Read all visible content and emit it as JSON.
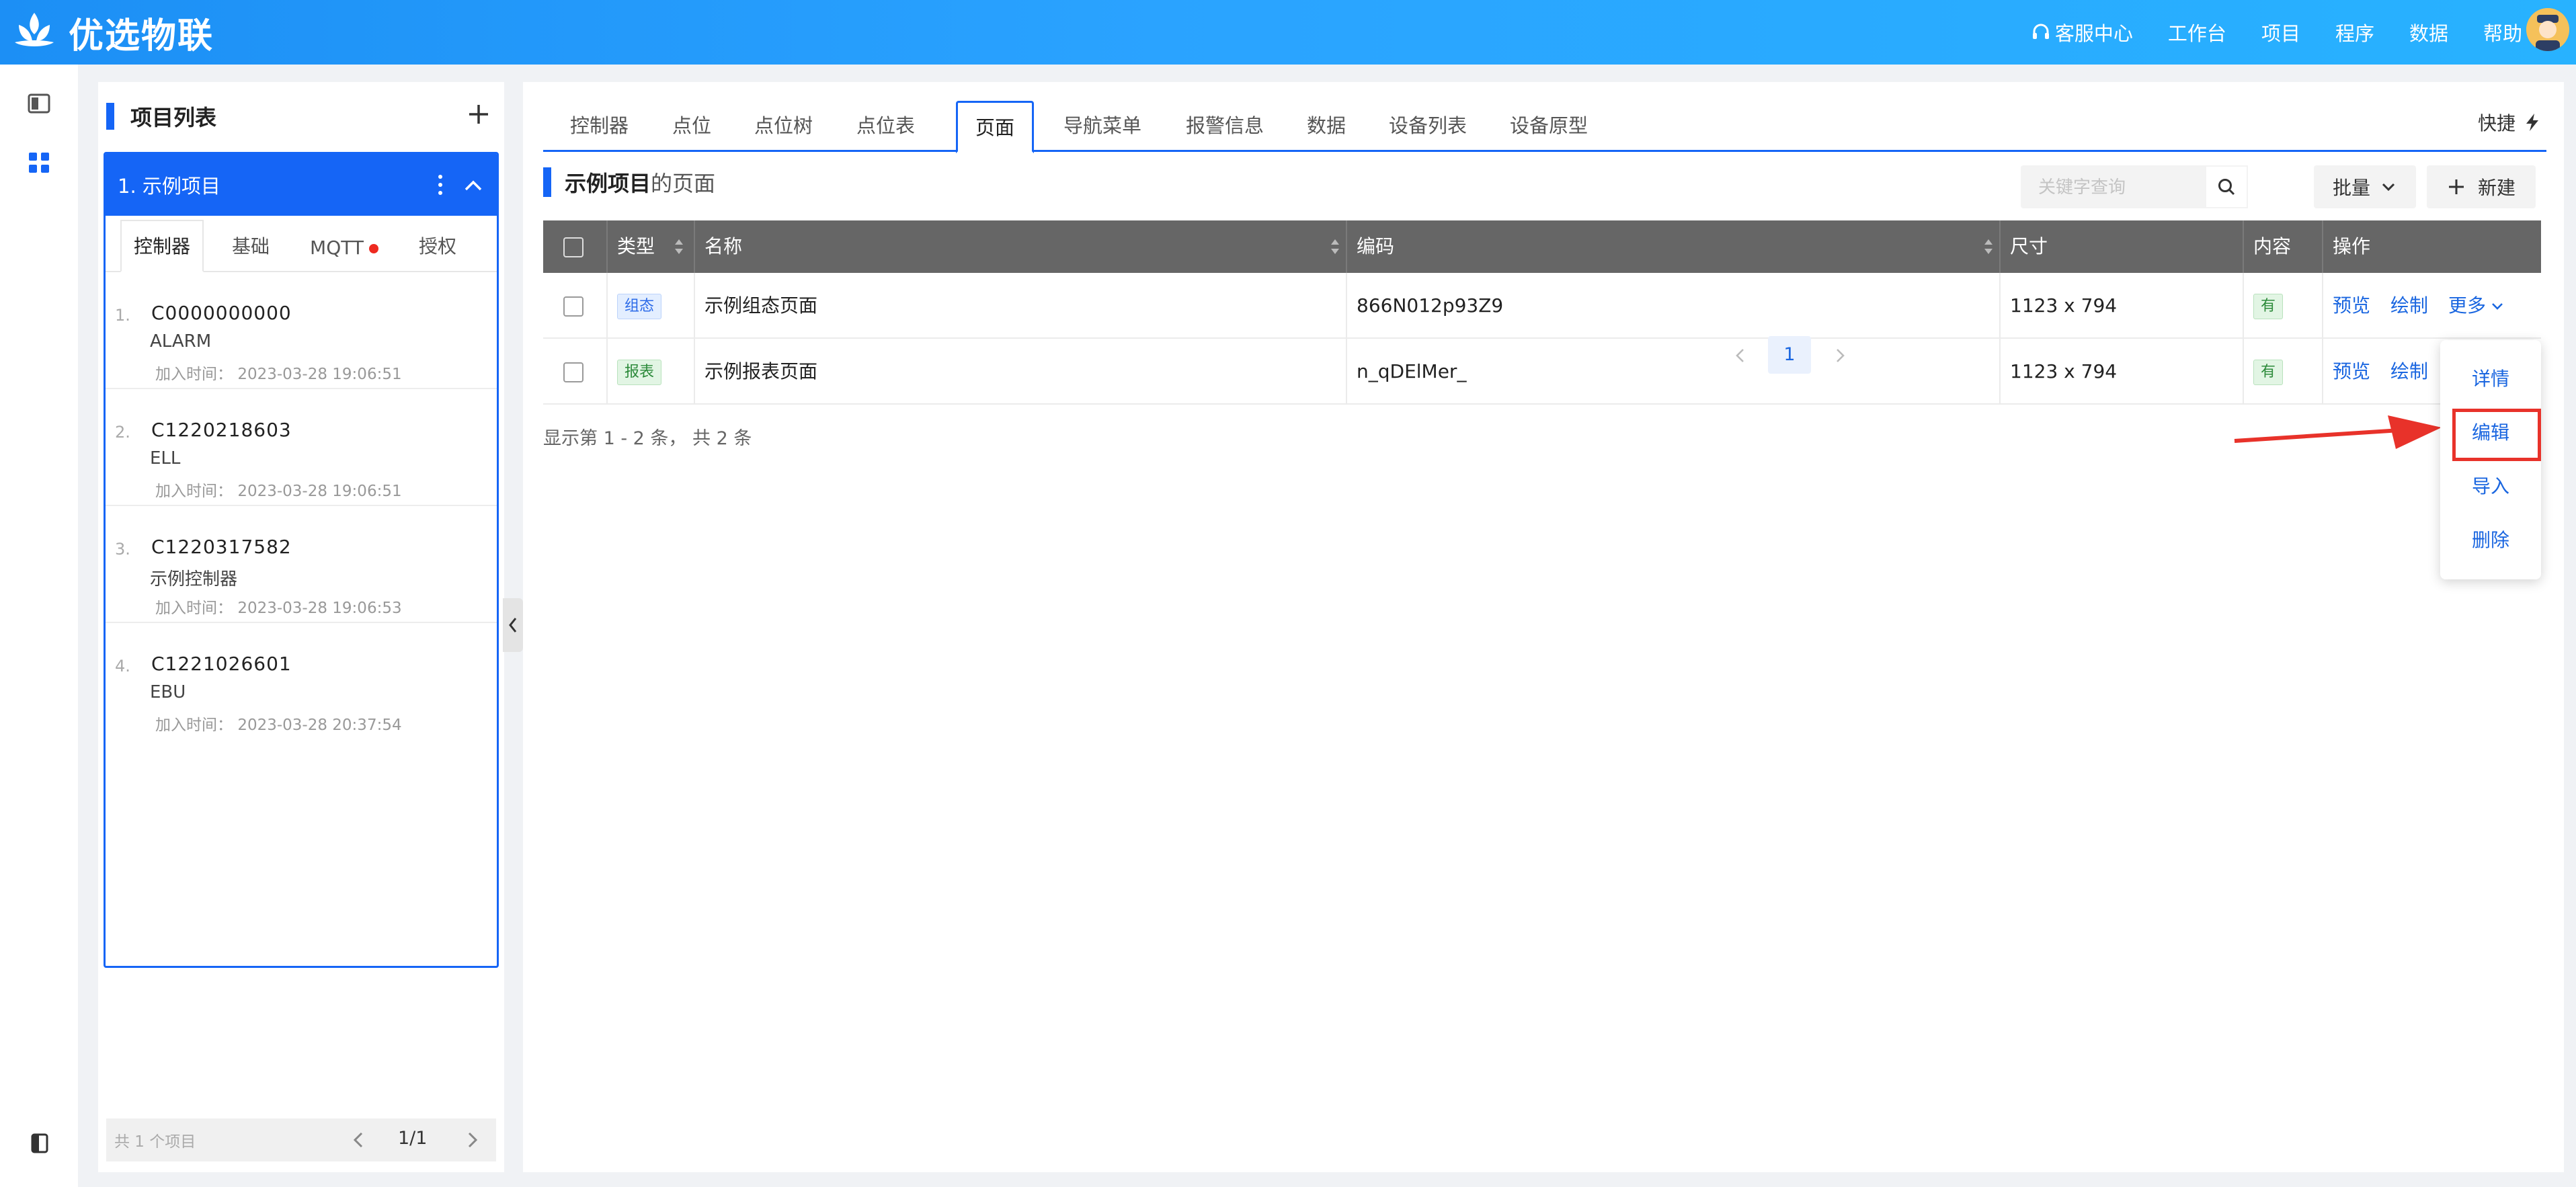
{
  "brand": {
    "name": "优选物联"
  },
  "topnav": {
    "service": "客服中心",
    "workbench": "工作台",
    "project": "项目",
    "program": "程序",
    "data": "数据",
    "help": "帮助"
  },
  "project_panel": {
    "title": "项目列表",
    "selected_project": "1. 示例项目",
    "sub_tabs": [
      "控制器",
      "基础",
      "MQTT",
      "授权"
    ],
    "active_sub_tab": "控制器",
    "time_label": "加入时间：",
    "controllers": [
      {
        "index": "1.",
        "code": "C0000000000",
        "name": "ALARM",
        "time": "2023-03-28 19:06:51"
      },
      {
        "index": "2.",
        "code": "C1220218603",
        "name": "ELL",
        "time": "2023-03-28 19:06:51"
      },
      {
        "index": "3.",
        "code": "C1220317582",
        "name": "示例控制器",
        "time": "2023-03-28 19:06:53"
      },
      {
        "index": "4.",
        "code": "C1221026601",
        "name": "EBU",
        "time": "2023-03-28 20:37:54"
      }
    ],
    "footer_total": "共 1 个项目",
    "footer_page": "1/1"
  },
  "main": {
    "tabs": [
      "控制器",
      "点位",
      "点位树",
      "点位表",
      "页面",
      "导航菜单",
      "报警信息",
      "数据",
      "设备列表",
      "设备原型"
    ],
    "active_tab": "页面",
    "quick_label": "快捷",
    "section_project": "示例项目",
    "section_suffix": "的页面",
    "search_placeholder": "关键字查询",
    "batch_label": "批量",
    "new_label": "新建",
    "columns": [
      "类型",
      "名称",
      "编码",
      "尺寸",
      "内容",
      "操作"
    ],
    "rows": [
      {
        "type": "组态",
        "type_color": "blue",
        "name": "示例组态页面",
        "code": "866N012p93Z9",
        "size": "1123 x 794",
        "content": "有"
      },
      {
        "type": "报表",
        "type_color": "green",
        "name": "示例报表页面",
        "code": "n_qDElMer_",
        "size": "1123 x 794",
        "content": "有"
      }
    ],
    "actions": {
      "preview": "预览",
      "draw": "绘制",
      "more": "更多"
    },
    "summary": "显示第 1 - 2 条， 共 2 条",
    "current_page": "1",
    "more_menu": [
      "详情",
      "编辑",
      "导入",
      "删除"
    ],
    "highlighted_menu_item": "编辑"
  },
  "colors": {
    "primary": "#1565f6",
    "header_gradient_start": "#1c8ff5",
    "highlight_red": "#e8322a",
    "table_header": "#666666"
  }
}
